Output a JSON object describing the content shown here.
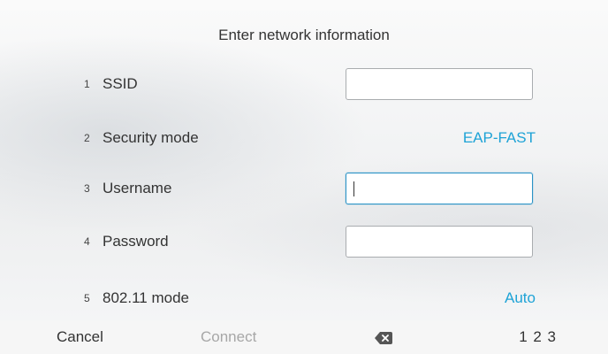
{
  "title": "Enter network information",
  "fields": [
    {
      "number": "1",
      "label": "SSID",
      "type": "input",
      "value": ""
    },
    {
      "number": "2",
      "label": "Security mode",
      "type": "select",
      "value": "EAP-FAST"
    },
    {
      "number": "3",
      "label": "Username",
      "type": "input",
      "value": "",
      "focused": true
    },
    {
      "number": "4",
      "label": "Password",
      "type": "input",
      "value": ""
    },
    {
      "number": "5",
      "label": "802.11 mode",
      "type": "select",
      "value": "Auto"
    }
  ],
  "bottom_bar": {
    "cancel_label": "Cancel",
    "connect_label": "Connect",
    "backspace_icon": "backspace-icon",
    "numbers_label": "1 2 3"
  },
  "colors": {
    "accent": "#1ea3d6",
    "disabled": "#a7a7a7",
    "focus_border": "#2b93c6"
  }
}
